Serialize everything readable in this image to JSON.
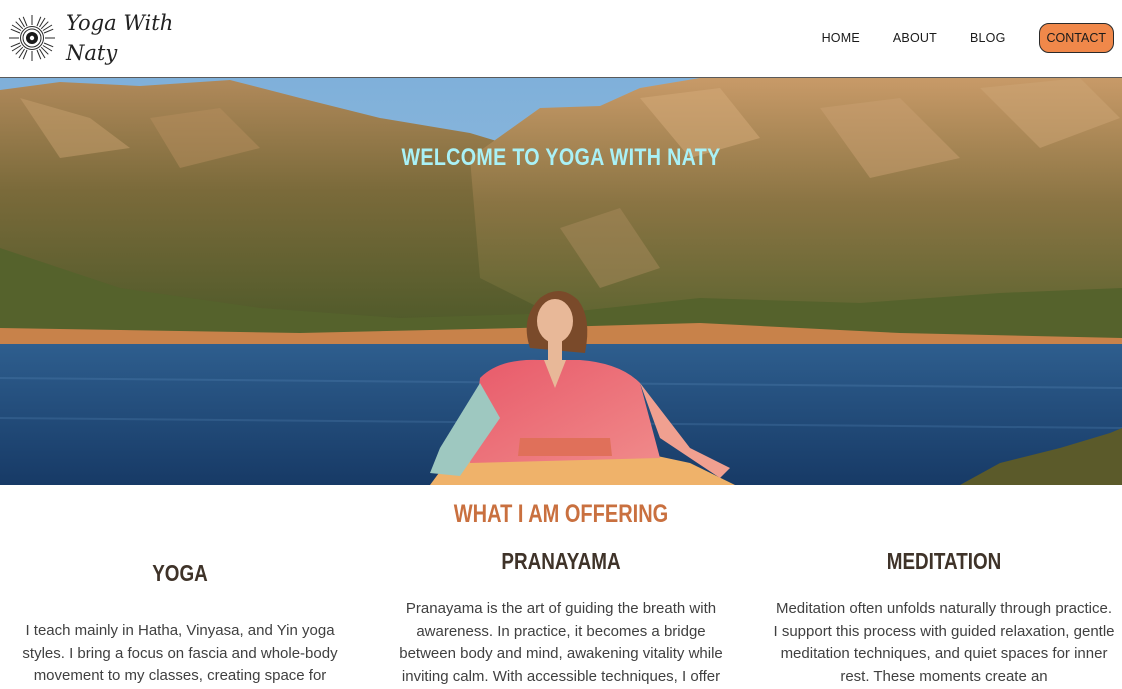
{
  "brand": {
    "name_line1": "Yoga With",
    "name_line2": "Naty",
    "logo_icon": "sun-mandala-icon"
  },
  "nav": {
    "home": "HOME",
    "about": "ABOUT",
    "blog": "BLOG",
    "contact": "CONTACT",
    "contact_color": "#f0884a"
  },
  "hero": {
    "title": "WELCOME TO YOGA WITH NATY",
    "title_color": "#a9f1f6"
  },
  "offering": {
    "title": "WHAT I AM OFFERING",
    "title_color": "#c9703f",
    "items": [
      {
        "heading": "YOGA",
        "text": "I teach mainly in Hatha, Vinyasa, and Yin yoga styles. I bring a focus on fascia and whole-body movement to my classes, creating space for"
      },
      {
        "heading": "PRANAYAMA",
        "text": "Pranayama is the art of guiding the breath with awareness. In practice, it becomes a bridge between body and mind, awakening vitality while inviting calm. With accessible techniques, I offer a"
      },
      {
        "heading": "MEDITATION",
        "text": "Meditation often unfolds naturally through practice. I support this process with guided relaxation, gentle meditation techniques, and quiet spaces for inner rest. These moments create an"
      }
    ]
  }
}
